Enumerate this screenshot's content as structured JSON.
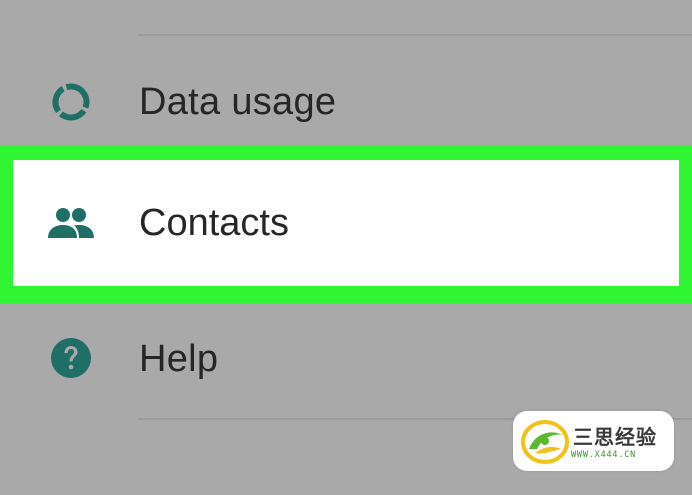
{
  "menu": {
    "items": [
      {
        "label": "Data usage",
        "icon": "data-usage-icon"
      },
      {
        "label": "Contacts",
        "icon": "contacts-icon",
        "highlighted": true
      },
      {
        "label": "Help",
        "icon": "help-icon"
      }
    ]
  },
  "watermark": {
    "title": "三思经验",
    "url": "WWW.X444.CN"
  },
  "colors": {
    "background": "#a9a9a9",
    "icon": "#1f6f66",
    "highlight_border": "#30f533",
    "text": "#262626"
  }
}
